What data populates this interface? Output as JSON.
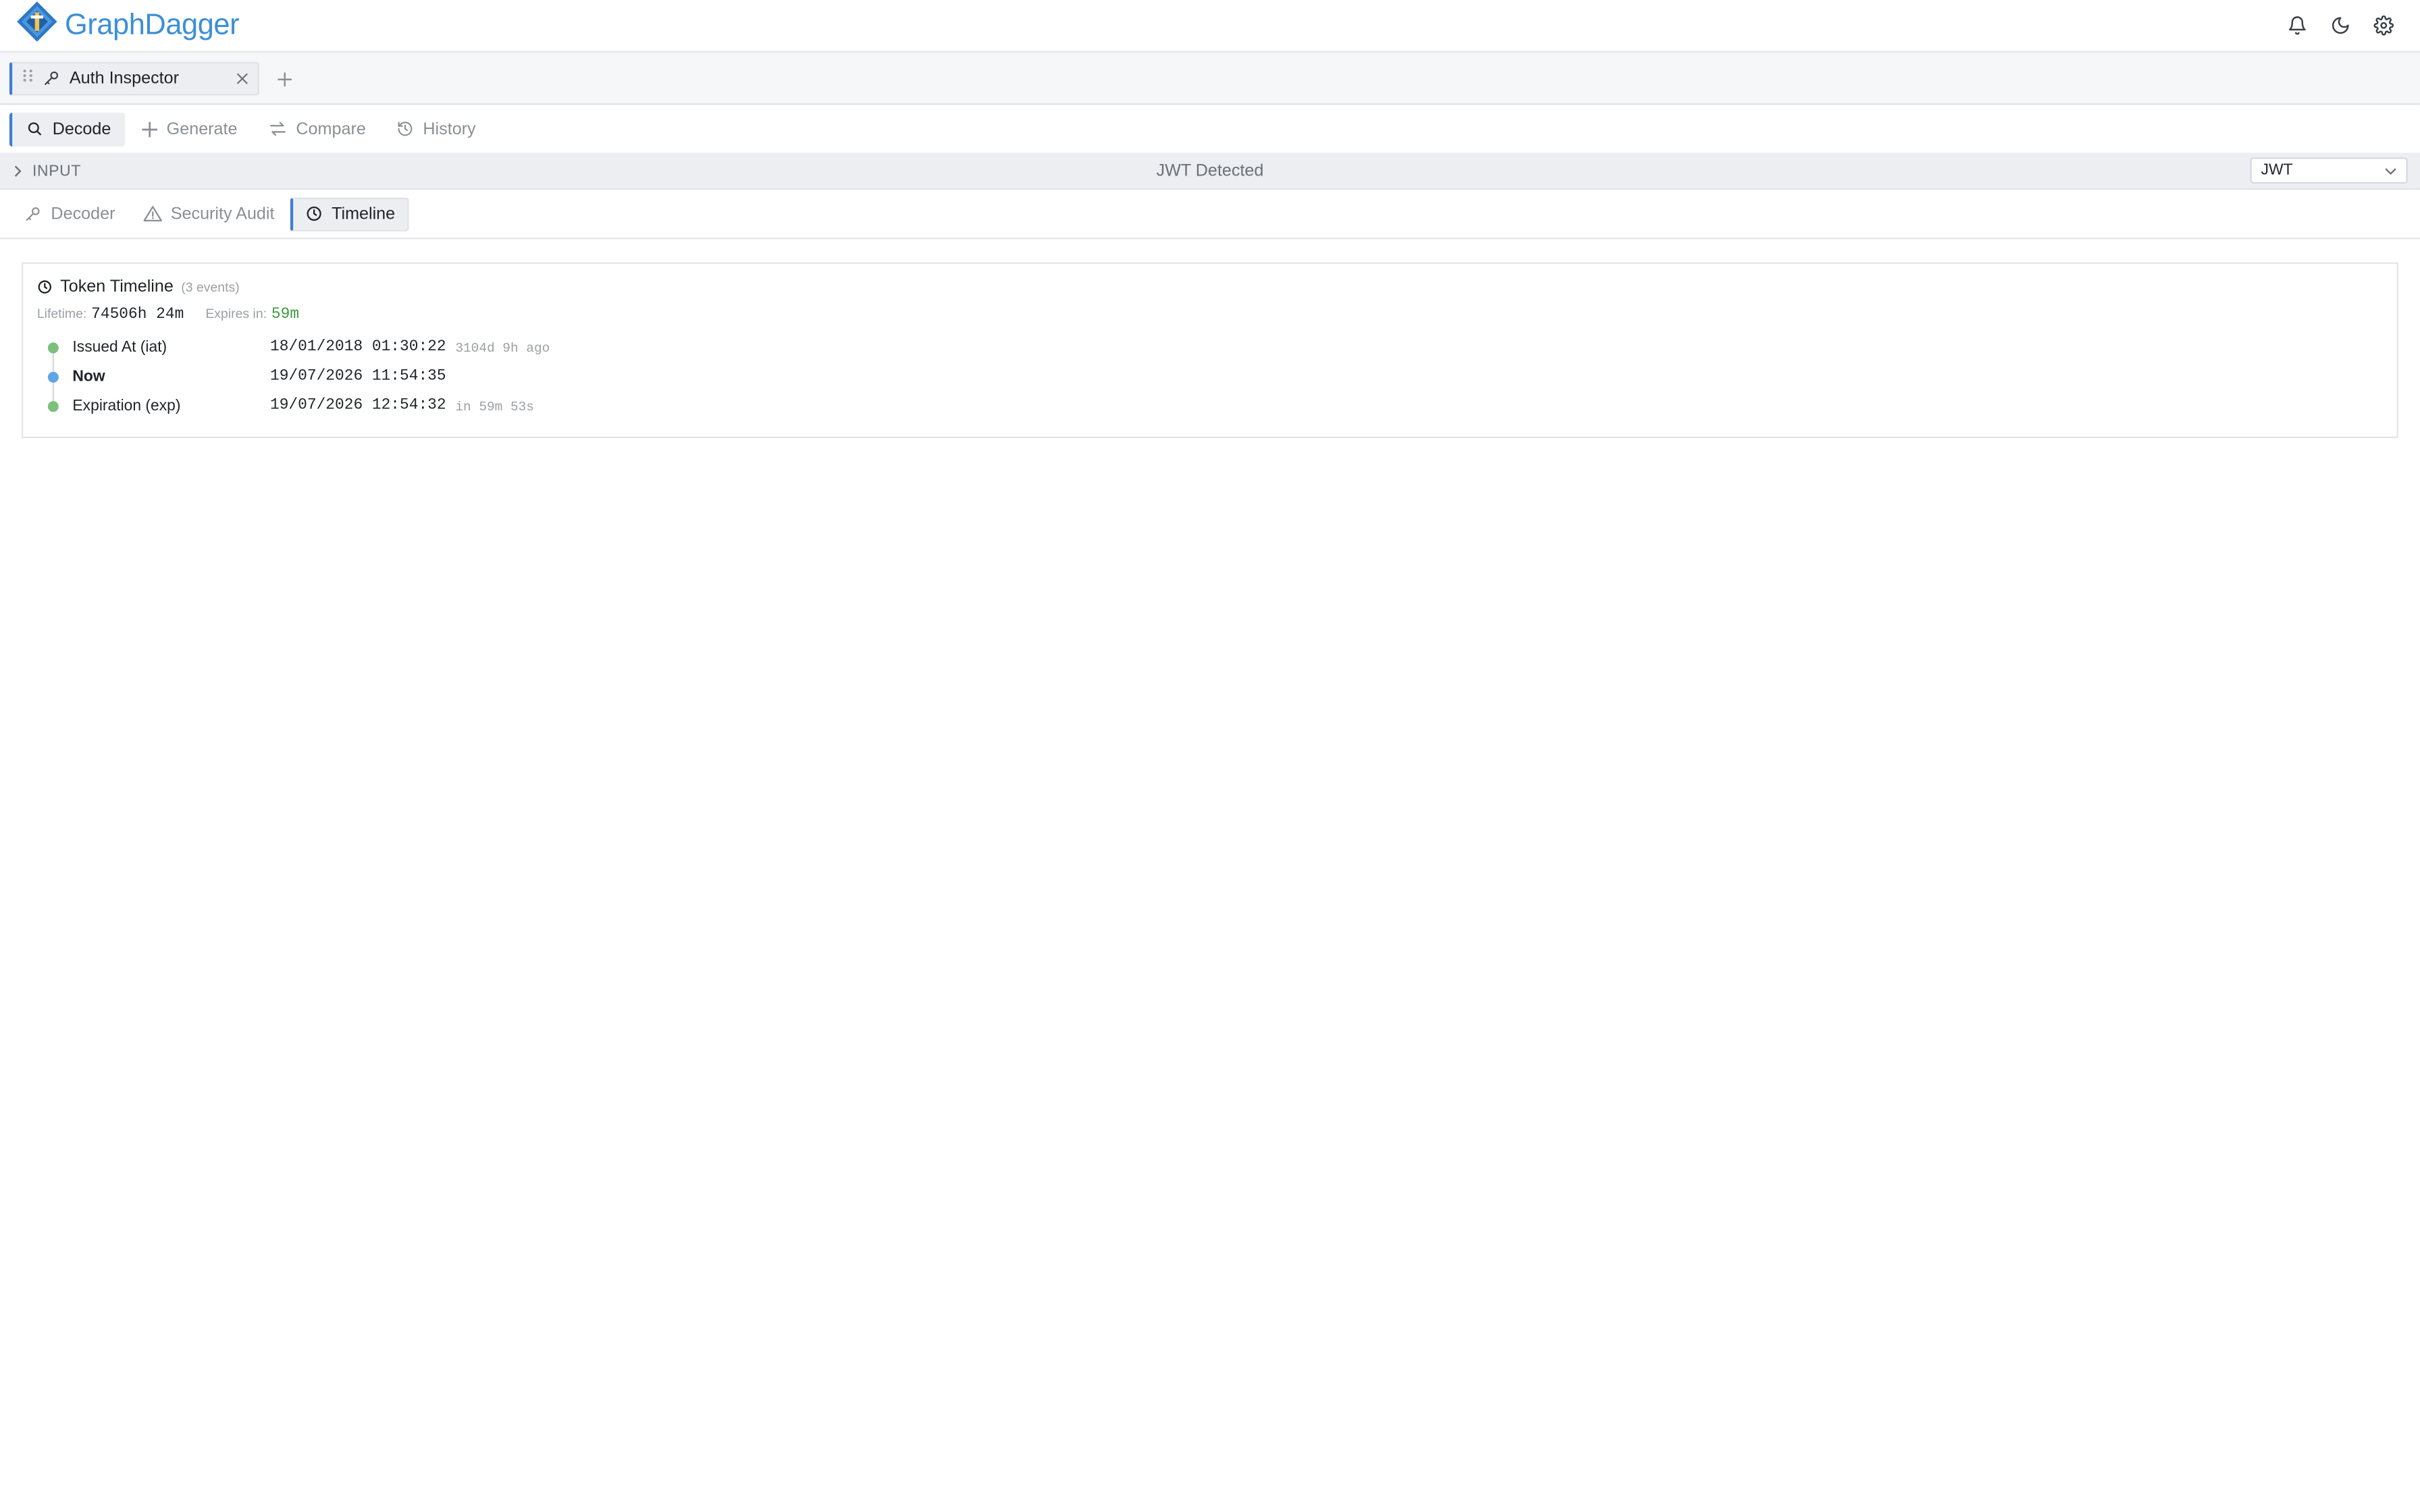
{
  "app": {
    "name": "GraphDagger"
  },
  "tabs": [
    {
      "label": "Auth Inspector"
    }
  ],
  "modes": [
    {
      "label": "Decode",
      "active": true
    },
    {
      "label": "Generate"
    },
    {
      "label": "Compare"
    },
    {
      "label": "History"
    }
  ],
  "input_bar": {
    "label": "INPUT",
    "status": "JWT Detected",
    "format_selected": "JWT"
  },
  "subtabs": [
    {
      "label": "Decoder"
    },
    {
      "label": "Security Audit"
    },
    {
      "label": "Timeline",
      "active": true
    }
  ],
  "timeline": {
    "title": "Token Timeline",
    "count": "(3 events)",
    "lifetime_label": "Lifetime:",
    "lifetime_value": "74506h 24m",
    "expires_label": "Expires in:",
    "expires_value": "59m",
    "events": [
      {
        "name": "Issued At (iat)",
        "time": "18/01/2018 01:30:22",
        "relative": "3104d 9h ago",
        "color": "#7cc07c"
      },
      {
        "name": "Now",
        "time": "19/07/2026 11:54:35",
        "relative": "",
        "color": "#5ea5e8"
      },
      {
        "name": "Expiration (exp)",
        "time": "19/07/2026 12:54:32",
        "relative": "in 59m 53s",
        "color": "#7cc07c"
      }
    ]
  },
  "colors": {
    "accent": "#3d7fd0",
    "brand": "#3d8fd8",
    "success": "#3c9a3c"
  }
}
